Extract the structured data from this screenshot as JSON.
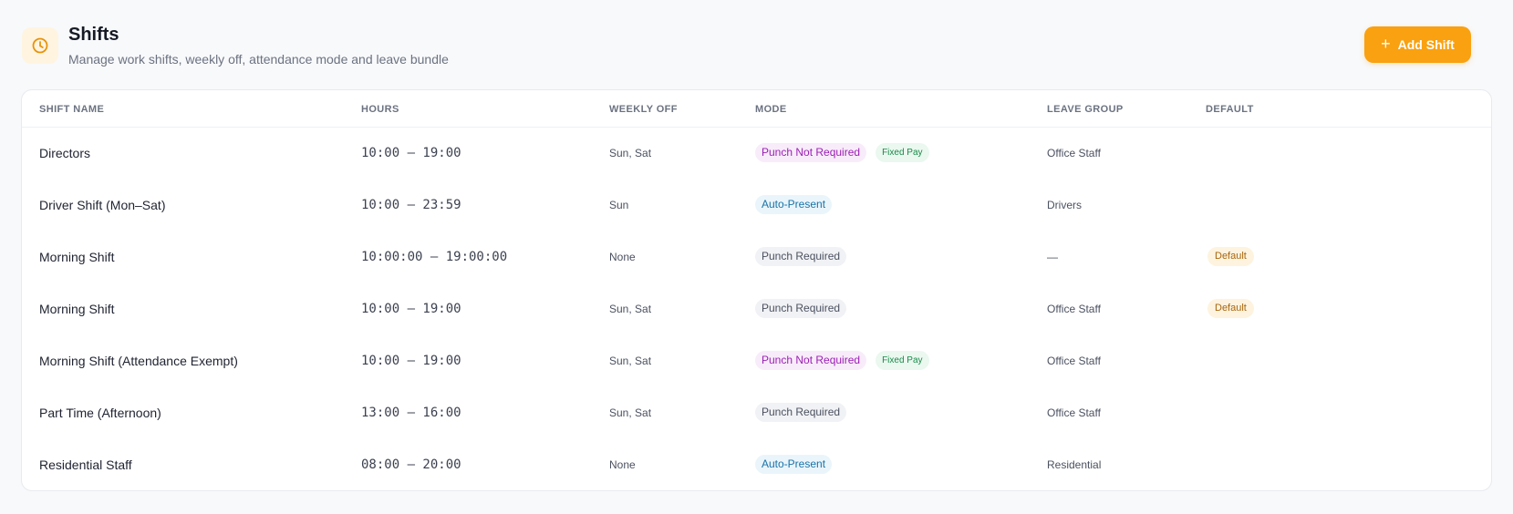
{
  "header": {
    "title": "Shifts",
    "subtitle": "Manage work shifts, weekly off, attendance mode and leave bundle",
    "add_button_label": "Add Shift",
    "icon": "clock-icon"
  },
  "colors": {
    "accent": "#f9a110",
    "mode_punch_not_required_bg": "#f8ecfa",
    "mode_punch_not_required_text": "#9b1fb4",
    "mode_auto_present_bg": "#eaf5fb",
    "mode_auto_present_text": "#1a73a8",
    "mode_punch_required_bg": "#f1f2f5",
    "mode_punch_required_text": "#4b5160",
    "fixed_pay_bg": "#eaf8ef",
    "fixed_pay_text": "#1a8a4a",
    "default_bg": "#fdf3df",
    "default_text": "#a8660d"
  },
  "table": {
    "columns": [
      "Shift Name",
      "Hours",
      "Weekly Off",
      "Mode",
      "Leave Group",
      "Default"
    ],
    "rows": [
      {
        "name": "Directors",
        "hours": "10:00 – 19:00",
        "weekly_off": "Sun, Sat",
        "mode": "Punch Not Required",
        "mode_kind": "not_required",
        "fixed_pay": "Fixed Pay",
        "leave_group": "Office Staff",
        "default": ""
      },
      {
        "name": "Driver Shift (Mon–Sat)",
        "hours": "10:00 – 23:59",
        "weekly_off": "Sun",
        "mode": "Auto-Present",
        "mode_kind": "auto",
        "fixed_pay": "",
        "leave_group": "Drivers",
        "default": ""
      },
      {
        "name": "Morning Shift",
        "hours": "10:00:00 – 19:00:00",
        "weekly_off": "None",
        "mode": "Punch Required",
        "mode_kind": "required",
        "fixed_pay": "",
        "leave_group": "—",
        "default": "Default"
      },
      {
        "name": "Morning Shift",
        "hours": "10:00 – 19:00",
        "weekly_off": "Sun, Sat",
        "mode": "Punch Required",
        "mode_kind": "required",
        "fixed_pay": "",
        "leave_group": "Office Staff",
        "default": "Default"
      },
      {
        "name": "Morning Shift (Attendance Exempt)",
        "hours": "10:00 – 19:00",
        "weekly_off": "Sun, Sat",
        "mode": "Punch Not Required",
        "mode_kind": "not_required",
        "fixed_pay": "Fixed Pay",
        "leave_group": "Office Staff",
        "default": ""
      },
      {
        "name": "Part Time (Afternoon)",
        "hours": "13:00 – 16:00",
        "weekly_off": "Sun, Sat",
        "mode": "Punch Required",
        "mode_kind": "required",
        "fixed_pay": "",
        "leave_group": "Office Staff",
        "default": ""
      },
      {
        "name": "Residential Staff",
        "hours": "08:00 – 20:00",
        "weekly_off": "None",
        "mode": "Auto-Present",
        "mode_kind": "auto",
        "fixed_pay": "",
        "leave_group": "Residential",
        "default": ""
      }
    ]
  }
}
